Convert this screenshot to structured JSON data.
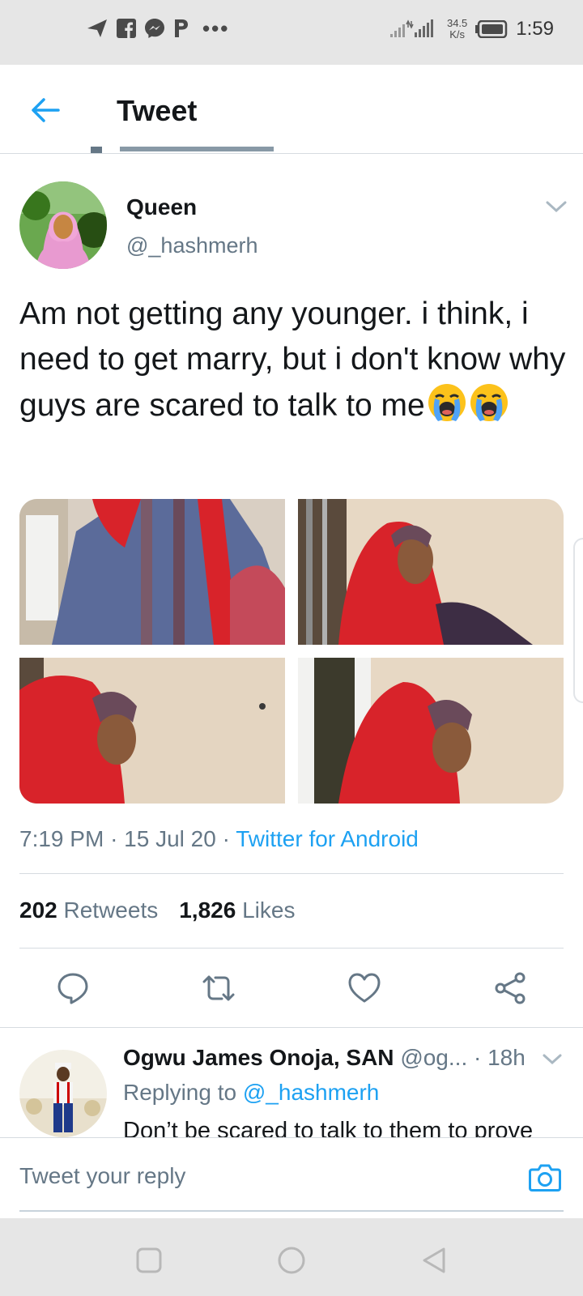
{
  "status_bar": {
    "time": "1:59",
    "net_speed_value": "34.5",
    "net_speed_unit": "K/s",
    "notification_icons": [
      "send-icon",
      "facebook-icon",
      "messenger-icon",
      "p-app-icon"
    ],
    "more_dots": "•••"
  },
  "header": {
    "title": "Tweet",
    "back_icon": "back-arrow-icon"
  },
  "tweet": {
    "author_name": "Queen",
    "author_handle": "@_hashmerh",
    "text": "Am not getting any younger. i think, i need to get marry, but i don't know why guys are scared to talk to me",
    "emojis": [
      "loudly-crying-face",
      "loudly-crying-face"
    ],
    "time": "7:19 PM",
    "date": "15 Jul 20",
    "separator": "·",
    "source": "Twitter for Android",
    "retweets_count": "202",
    "retweets_label": "Retweets",
    "likes_count": "1,826",
    "likes_label": "Likes",
    "photos": [
      "photo-1",
      "photo-2",
      "photo-3",
      "photo-4"
    ],
    "actions": [
      "reply-icon",
      "retweet-icon",
      "like-icon",
      "share-icon"
    ]
  },
  "reply": {
    "author_name": "Ogwu James Onoja, SAN",
    "author_handle": "@og...",
    "age": "18h",
    "replying_label": "Replying to",
    "replying_to": "@_hashmerh",
    "text": "Don’t be scared to talk to them to prove"
  },
  "composer": {
    "placeholder": "Tweet your reply",
    "camera_icon": "camera-icon"
  },
  "nav_bar": {
    "buttons": [
      "recents-square-icon",
      "home-circle-icon",
      "back-triangle-icon"
    ]
  },
  "colors": {
    "accent": "#1da1f2",
    "secondary_text": "#657786",
    "primary_text": "#14171a",
    "system_bar": "#e6e6e6"
  }
}
